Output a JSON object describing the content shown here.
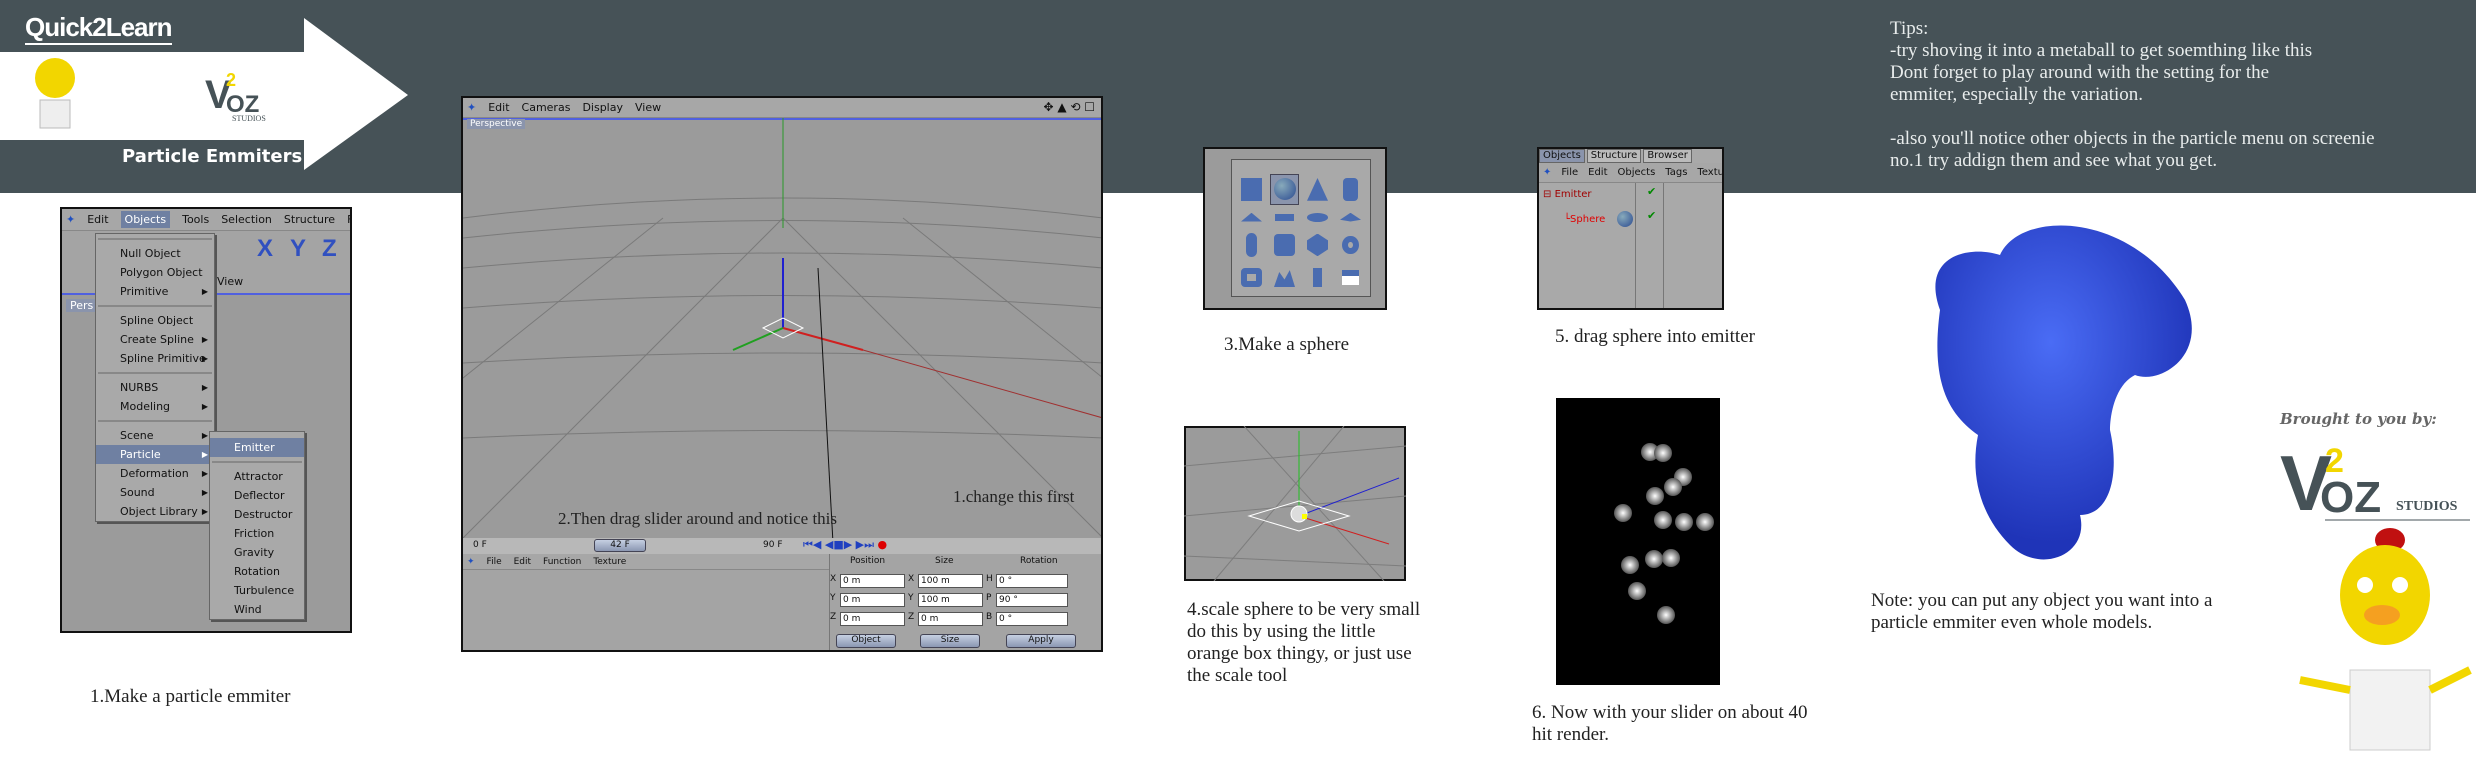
{
  "header": {
    "brand": "Quick2Learn",
    "logo": "V2OZ STUDIOS",
    "title": "Particle Emmiters",
    "band_color": "#465257"
  },
  "shot1": {
    "menubar": [
      "Edit",
      "Objects",
      "Tools",
      "Selection",
      "Structure",
      "Functions"
    ],
    "viewport_label": "Pers",
    "view_label": "View",
    "axis_buttons": [
      "X",
      "Y",
      "Z"
    ],
    "menu": [
      {
        "label": "Null Object",
        "icon": "null-object-icon"
      },
      {
        "label": "Polygon Object",
        "icon": "polygon-icon"
      },
      {
        "label": "Primitive",
        "sub": true
      },
      {
        "sep": true
      },
      {
        "label": "Spline Object",
        "icon": "spline-icon"
      },
      {
        "label": "Create Spline",
        "sub": true
      },
      {
        "label": "Spline Primitive",
        "sub": true
      },
      {
        "sep": true
      },
      {
        "label": "NURBS",
        "sub": true
      },
      {
        "label": "Modeling",
        "sub": true
      },
      {
        "sep": true
      },
      {
        "label": "Scene",
        "sub": true
      },
      {
        "label": "Particle",
        "sub": true,
        "highlighted": true
      },
      {
        "label": "Deformation",
        "sub": true
      },
      {
        "label": "Sound",
        "sub": true
      },
      {
        "label": "Object Library",
        "sub": true
      }
    ],
    "submenu": [
      "Emitter",
      "Attractor",
      "Deflector",
      "Destructor",
      "Friction",
      "Gravity",
      "Rotation",
      "Turbulence",
      "Wind"
    ],
    "caption": "1.Make a particle emmiter"
  },
  "shot2": {
    "menubar": [
      "Edit",
      "Cameras",
      "Display",
      "View"
    ],
    "viewport_label": "Perspective",
    "timeline": {
      "start": "0 F",
      "current": "42 F",
      "end": "90 F",
      "current_fraction": 0.467
    },
    "lower_menu": [
      "File",
      "Edit",
      "Function",
      "Texture"
    ],
    "coords": {
      "headers": [
        "Position",
        "Size",
        "Rotation"
      ],
      "rows": [
        {
          "a": "X",
          "pos": "0 m",
          "s": "X",
          "size": "100 m",
          "r": "H",
          "rot": "0 °"
        },
        {
          "a": "Y",
          "pos": "0 m",
          "s": "Y",
          "size": "100 m",
          "r": "P",
          "rot": "90 °"
        },
        {
          "a": "Z",
          "pos": "0 m",
          "s": "Z",
          "size": "0 m",
          "r": "B",
          "rot": "0 °"
        }
      ],
      "mode": "Object",
      "size_mode": "Size",
      "apply": "Apply"
    },
    "note_slider": "2.Then drag slider around and notice this",
    "note_first": "1.change this first"
  },
  "shot3": {
    "caption": "3.Make a sphere"
  },
  "shot4": {
    "caption": "4.scale sphere to be very small do this by using the little orange box thingy, or just use the scale tool"
  },
  "shot5": {
    "tabs": [
      "Objects",
      "Structure",
      "Browser"
    ],
    "menubar": [
      "File",
      "Edit",
      "Objects",
      "Tags",
      "Texture"
    ],
    "tree": [
      "Emitter",
      "Sphere"
    ],
    "caption": "5. drag sphere into emitter"
  },
  "shot6": {
    "caption": "6. Now with your slider on about 40 hit render."
  },
  "tips": "Tips:\n-try shoving it into a metaball to get soemthing like this\nDont forget to play around with the setting for the\nemmiter, especially the variation.\n\n-also you'll notice other objects in the particle menu on screenie\nno.1 try addign them and see what you get.",
  "note": "Note: you can put any object you want into a particle emmiter even whole models.",
  "credits": {
    "brought": "Brought to you by:",
    "logo": "V2OZ STUDIOS"
  }
}
